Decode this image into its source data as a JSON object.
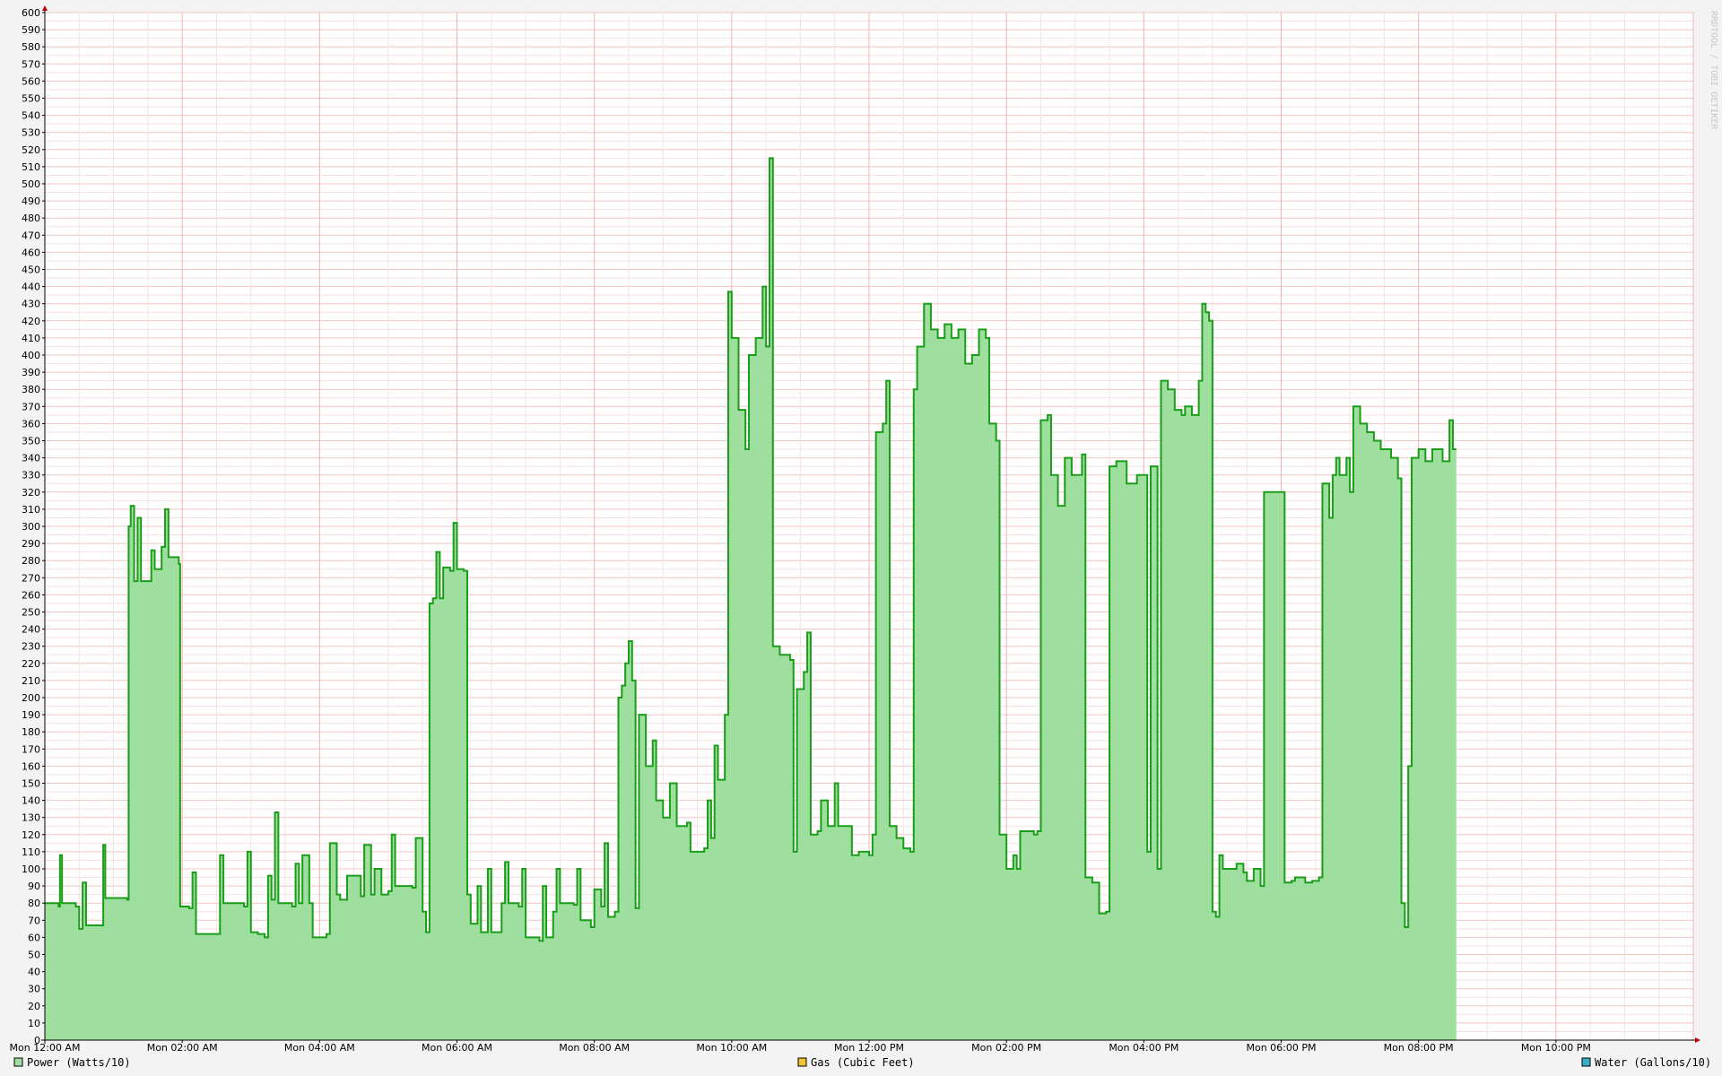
{
  "chart_data": {
    "type": "area",
    "title": "",
    "xlabel": "",
    "ylabel": "",
    "ylim": [
      0,
      600
    ],
    "xlim_hours": [
      0,
      24
    ],
    "y_major_step": 10,
    "y_ticks": [
      0,
      10,
      20,
      30,
      40,
      50,
      60,
      70,
      80,
      90,
      100,
      110,
      120,
      130,
      140,
      150,
      160,
      170,
      180,
      190,
      200,
      210,
      220,
      230,
      240,
      250,
      260,
      270,
      280,
      290,
      300,
      310,
      320,
      330,
      340,
      350,
      360,
      370,
      380,
      390,
      400,
      410,
      420,
      430,
      440,
      450,
      460,
      470,
      480,
      490,
      500,
      510,
      520,
      530,
      540,
      550,
      560,
      570,
      580,
      590,
      600
    ],
    "x_ticks": [
      {
        "hour": 0,
        "label": "Mon 12:00 AM"
      },
      {
        "hour": 2,
        "label": "Mon 02:00 AM"
      },
      {
        "hour": 4,
        "label": "Mon 04:00 AM"
      },
      {
        "hour": 6,
        "label": "Mon 06:00 AM"
      },
      {
        "hour": 8,
        "label": "Mon 08:00 AM"
      },
      {
        "hour": 10,
        "label": "Mon 10:00 AM"
      },
      {
        "hour": 12,
        "label": "Mon 12:00 PM"
      },
      {
        "hour": 14,
        "label": "Mon 02:00 PM"
      },
      {
        "hour": 16,
        "label": "Mon 04:00 PM"
      },
      {
        "hour": 18,
        "label": "Mon 06:00 PM"
      },
      {
        "hour": 20,
        "label": "Mon 08:00 PM"
      },
      {
        "hour": 22,
        "label": "Mon 10:00 PM"
      }
    ],
    "grid": true,
    "legend_position": "bottom",
    "watermark": "RRDTOOL / TOBI OETIKER",
    "series": [
      {
        "name": "Power (Watts/10)",
        "color": "#1a9e1a",
        "fill": "#9ede9e",
        "points": [
          [
            0,
            80
          ],
          [
            0.2,
            78
          ],
          [
            0.22,
            108
          ],
          [
            0.25,
            80
          ],
          [
            0.45,
            78
          ],
          [
            0.5,
            65
          ],
          [
            0.55,
            92
          ],
          [
            0.6,
            67
          ],
          [
            0.8,
            67
          ],
          [
            0.85,
            114
          ],
          [
            0.88,
            83
          ],
          [
            1.2,
            82
          ],
          [
            1.22,
            300
          ],
          [
            1.25,
            312
          ],
          [
            1.3,
            268
          ],
          [
            1.35,
            305
          ],
          [
            1.4,
            268
          ],
          [
            1.55,
            286
          ],
          [
            1.6,
            275
          ],
          [
            1.7,
            288
          ],
          [
            1.75,
            310
          ],
          [
            1.8,
            282
          ],
          [
            1.95,
            278
          ],
          [
            1.97,
            78
          ],
          [
            2.1,
            77
          ],
          [
            2.15,
            98
          ],
          [
            2.2,
            62
          ],
          [
            2.5,
            62
          ],
          [
            2.55,
            108
          ],
          [
            2.6,
            80
          ],
          [
            2.9,
            78
          ],
          [
            2.95,
            110
          ],
          [
            3.0,
            63
          ],
          [
            3.1,
            62
          ],
          [
            3.2,
            60
          ],
          [
            3.25,
            96
          ],
          [
            3.3,
            82
          ],
          [
            3.35,
            133
          ],
          [
            3.4,
            80
          ],
          [
            3.6,
            78
          ],
          [
            3.65,
            103
          ],
          [
            3.7,
            80
          ],
          [
            3.75,
            108
          ],
          [
            3.85,
            80
          ],
          [
            3.9,
            60
          ],
          [
            4.1,
            62
          ],
          [
            4.15,
            115
          ],
          [
            4.25,
            85
          ],
          [
            4.3,
            82
          ],
          [
            4.4,
            96
          ],
          [
            4.6,
            84
          ],
          [
            4.65,
            114
          ],
          [
            4.75,
            85
          ],
          [
            4.8,
            100
          ],
          [
            4.9,
            85
          ],
          [
            5.0,
            87
          ],
          [
            5.05,
            120
          ],
          [
            5.1,
            90
          ],
          [
            5.35,
            89
          ],
          [
            5.4,
            118
          ],
          [
            5.5,
            75
          ],
          [
            5.55,
            63
          ],
          [
            5.6,
            255
          ],
          [
            5.65,
            258
          ],
          [
            5.7,
            285
          ],
          [
            5.75,
            258
          ],
          [
            5.8,
            276
          ],
          [
            5.9,
            274
          ],
          [
            5.95,
            302
          ],
          [
            6.0,
            275
          ],
          [
            6.1,
            274
          ],
          [
            6.15,
            85
          ],
          [
            6.2,
            68
          ],
          [
            6.3,
            90
          ],
          [
            6.35,
            63
          ],
          [
            6.45,
            100
          ],
          [
            6.5,
            63
          ],
          [
            6.65,
            80
          ],
          [
            6.7,
            104
          ],
          [
            6.75,
            80
          ],
          [
            6.9,
            78
          ],
          [
            6.95,
            100
          ],
          [
            7.0,
            60
          ],
          [
            7.2,
            58
          ],
          [
            7.25,
            90
          ],
          [
            7.3,
            60
          ],
          [
            7.4,
            75
          ],
          [
            7.45,
            100
          ],
          [
            7.5,
            80
          ],
          [
            7.7,
            79
          ],
          [
            7.75,
            100
          ],
          [
            7.8,
            70
          ],
          [
            7.95,
            66
          ],
          [
            8.0,
            88
          ],
          [
            8.1,
            78
          ],
          [
            8.15,
            115
          ],
          [
            8.2,
            72
          ],
          [
            8.3,
            75
          ],
          [
            8.35,
            200
          ],
          [
            8.4,
            207
          ],
          [
            8.45,
            220
          ],
          [
            8.5,
            233
          ],
          [
            8.55,
            210
          ],
          [
            8.6,
            77
          ],
          [
            8.65,
            190
          ],
          [
            8.75,
            160
          ],
          [
            8.85,
            175
          ],
          [
            8.9,
            140
          ],
          [
            9.0,
            130
          ],
          [
            9.1,
            150
          ],
          [
            9.2,
            125
          ],
          [
            9.35,
            127
          ],
          [
            9.4,
            110
          ],
          [
            9.6,
            112
          ],
          [
            9.65,
            140
          ],
          [
            9.7,
            118
          ],
          [
            9.75,
            172
          ],
          [
            9.8,
            152
          ],
          [
            9.9,
            190
          ],
          [
            9.95,
            437
          ],
          [
            10.0,
            410
          ],
          [
            10.1,
            368
          ],
          [
            10.2,
            345
          ],
          [
            10.25,
            400
          ],
          [
            10.35,
            410
          ],
          [
            10.45,
            440
          ],
          [
            10.5,
            405
          ],
          [
            10.55,
            515
          ],
          [
            10.6,
            230
          ],
          [
            10.7,
            225
          ],
          [
            10.85,
            222
          ],
          [
            10.9,
            110
          ],
          [
            10.95,
            205
          ],
          [
            11.05,
            215
          ],
          [
            11.1,
            238
          ],
          [
            11.15,
            120
          ],
          [
            11.25,
            122
          ],
          [
            11.3,
            140
          ],
          [
            11.4,
            125
          ],
          [
            11.5,
            150
          ],
          [
            11.55,
            125
          ],
          [
            11.7,
            125
          ],
          [
            11.75,
            108
          ],
          [
            11.85,
            110
          ],
          [
            12.0,
            108
          ],
          [
            12.05,
            120
          ],
          [
            12.1,
            355
          ],
          [
            12.2,
            360
          ],
          [
            12.25,
            385
          ],
          [
            12.3,
            125
          ],
          [
            12.4,
            118
          ],
          [
            12.5,
            112
          ],
          [
            12.6,
            110
          ],
          [
            12.65,
            380
          ],
          [
            12.7,
            405
          ],
          [
            12.8,
            430
          ],
          [
            12.9,
            415
          ],
          [
            13.0,
            410
          ],
          [
            13.1,
            418
          ],
          [
            13.2,
            410
          ],
          [
            13.3,
            415
          ],
          [
            13.4,
            395
          ],
          [
            13.5,
            400
          ],
          [
            13.6,
            415
          ],
          [
            13.7,
            410
          ],
          [
            13.75,
            360
          ],
          [
            13.85,
            350
          ],
          [
            13.9,
            120
          ],
          [
            14.0,
            100
          ],
          [
            14.1,
            108
          ],
          [
            14.15,
            100
          ],
          [
            14.2,
            122
          ],
          [
            14.4,
            120
          ],
          [
            14.45,
            122
          ],
          [
            14.5,
            362
          ],
          [
            14.6,
            365
          ],
          [
            14.65,
            330
          ],
          [
            14.75,
            312
          ],
          [
            14.85,
            340
          ],
          [
            14.95,
            330
          ],
          [
            15.05,
            330
          ],
          [
            15.1,
            342
          ],
          [
            15.15,
            95
          ],
          [
            15.25,
            92
          ],
          [
            15.35,
            74
          ],
          [
            15.45,
            75
          ],
          [
            15.5,
            335
          ],
          [
            15.6,
            338
          ],
          [
            15.75,
            325
          ],
          [
            15.9,
            330
          ],
          [
            16.05,
            110
          ],
          [
            16.1,
            335
          ],
          [
            16.15,
            335
          ],
          [
            16.2,
            100
          ],
          [
            16.25,
            385
          ],
          [
            16.35,
            380
          ],
          [
            16.45,
            368
          ],
          [
            16.55,
            365
          ],
          [
            16.6,
            370
          ],
          [
            16.7,
            365
          ],
          [
            16.8,
            385
          ],
          [
            16.85,
            430
          ],
          [
            16.9,
            425
          ],
          [
            16.95,
            420
          ],
          [
            17.0,
            75
          ],
          [
            17.05,
            72
          ],
          [
            17.1,
            108
          ],
          [
            17.15,
            100
          ],
          [
            17.25,
            100
          ],
          [
            17.35,
            103
          ],
          [
            17.45,
            98
          ],
          [
            17.5,
            93
          ],
          [
            17.6,
            100
          ],
          [
            17.7,
            90
          ],
          [
            17.75,
            320
          ],
          [
            17.85,
            320
          ],
          [
            18.0,
            320
          ],
          [
            18.05,
            92
          ],
          [
            18.15,
            93
          ],
          [
            18.2,
            95
          ],
          [
            18.3,
            95
          ],
          [
            18.35,
            92
          ],
          [
            18.45,
            93
          ],
          [
            18.55,
            95
          ],
          [
            18.6,
            325
          ],
          [
            18.7,
            305
          ],
          [
            18.75,
            330
          ],
          [
            18.8,
            340
          ],
          [
            18.85,
            330
          ],
          [
            18.95,
            340
          ],
          [
            19.0,
            320
          ],
          [
            19.05,
            370
          ],
          [
            19.15,
            360
          ],
          [
            19.25,
            355
          ],
          [
            19.35,
            350
          ],
          [
            19.45,
            345
          ],
          [
            19.55,
            345
          ],
          [
            19.6,
            340
          ],
          [
            19.7,
            328
          ],
          [
            19.75,
            80
          ],
          [
            19.8,
            66
          ],
          [
            19.85,
            160
          ],
          [
            19.9,
            340
          ],
          [
            20.0,
            345
          ],
          [
            20.1,
            338
          ],
          [
            20.2,
            345
          ],
          [
            20.35,
            338
          ],
          [
            20.45,
            362
          ],
          [
            20.5,
            345
          ],
          [
            20.55,
            345
          ]
        ]
      },
      {
        "name": "Gas (Cubic Feet)",
        "color": "#e8a800",
        "fill": "#f4c430",
        "points": []
      },
      {
        "name": "Water (Gallons/10)",
        "color": "#1010a0",
        "fill": "#3ab0c8",
        "points": []
      }
    ]
  }
}
